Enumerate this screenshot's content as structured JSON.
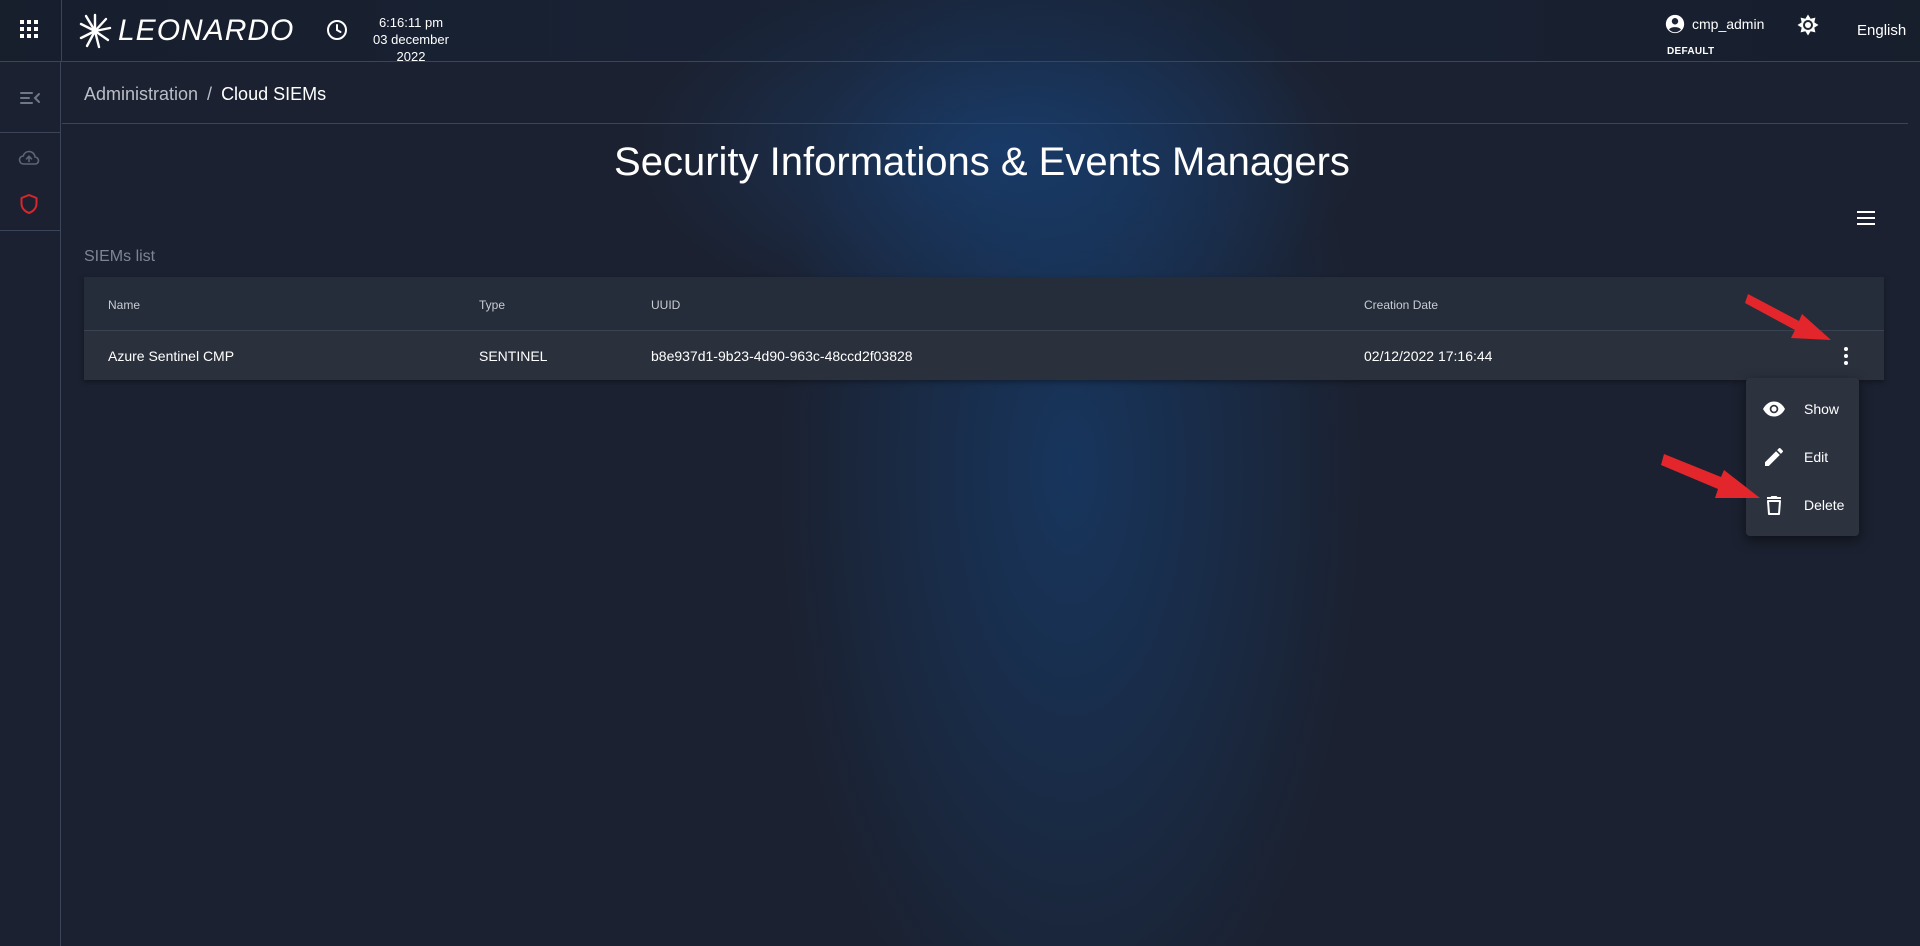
{
  "header": {
    "brand": "LEONARDO",
    "time": "6:16:11 pm",
    "date": "03 december 2022",
    "user": "cmp_admin",
    "tenant": "DEFAULT",
    "language": "English"
  },
  "sidebar": {
    "icons": [
      "collapse-menu-icon",
      "cloud-upload-icon",
      "shield-icon"
    ],
    "active_color": "#d9252c"
  },
  "breadcrumb": {
    "parent": "Administration",
    "separator": "/",
    "current": "Cloud SIEMs"
  },
  "page": {
    "title": "Security Informations & Events Managers",
    "section_label": "SIEMs list"
  },
  "table": {
    "columns": [
      "Name",
      "Type",
      "UUID",
      "Creation Date"
    ],
    "rows": [
      {
        "name": "Azure Sentinel CMP",
        "type": "SENTINEL",
        "uuid": "b8e937d1-9b23-4d90-963c-48ccd2f03828",
        "creation_date": "02/12/2022 17:16:44"
      }
    ]
  },
  "row_menu": {
    "items": [
      {
        "label": "Show",
        "icon": "eye-icon"
      },
      {
        "label": "Edit",
        "icon": "pencil-icon"
      },
      {
        "label": "Delete",
        "icon": "trash-icon"
      }
    ]
  },
  "annotations": {
    "arrow_color": "#e3262b"
  }
}
